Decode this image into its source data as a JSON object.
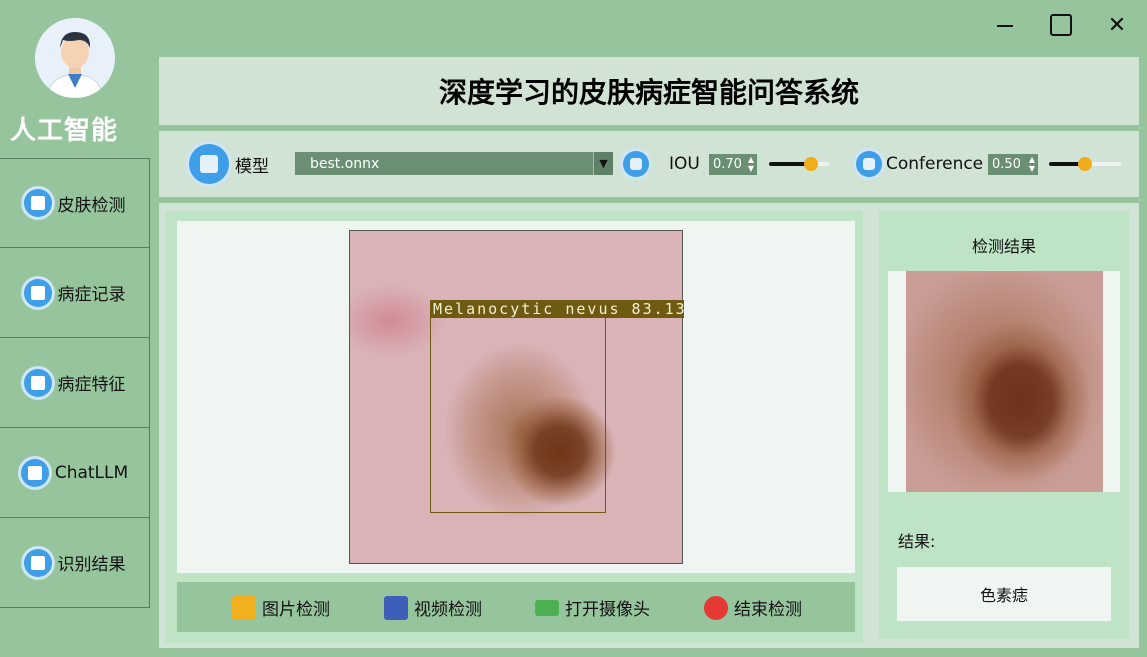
{
  "sidebar": {
    "brand": "人工智能",
    "items": [
      {
        "label": "皮肤检测",
        "icon": "skin-detect-icon"
      },
      {
        "label": "病症记录",
        "icon": "records-icon"
      },
      {
        "label": "病症特征",
        "icon": "features-icon"
      },
      {
        "label": "ChatLLM",
        "icon": "chat-icon"
      },
      {
        "label": "识别结果",
        "icon": "folder-icon"
      }
    ]
  },
  "window": {
    "minimize": "minimize-icon",
    "maximize": "maximize-icon",
    "close_glyph": "✕"
  },
  "header": {
    "title": "深度学习的皮肤病症智能问答系统"
  },
  "toolbar": {
    "model_label": "模型",
    "model_value": "best.onnx",
    "iou_label": "IOU",
    "iou_value": "0.70",
    "iou_slider_fraction": 0.7,
    "conf_label": "Conference",
    "conf_value": "0.50",
    "conf_slider_fraction": 0.5
  },
  "detection": {
    "box_label": "Melanocytic nevus 83.13"
  },
  "actions": {
    "image_detect": "图片检测",
    "video_detect": "视频检测",
    "open_camera": "打开摄像头",
    "stop_detect": "结束检测"
  },
  "result_panel": {
    "title": "检测结果",
    "result_label": "结果:",
    "result_value": "色素痣"
  },
  "colors": {
    "accent": "#3f9ee8",
    "slider_knob": "#f0ad1c",
    "background": "#96c59d"
  }
}
